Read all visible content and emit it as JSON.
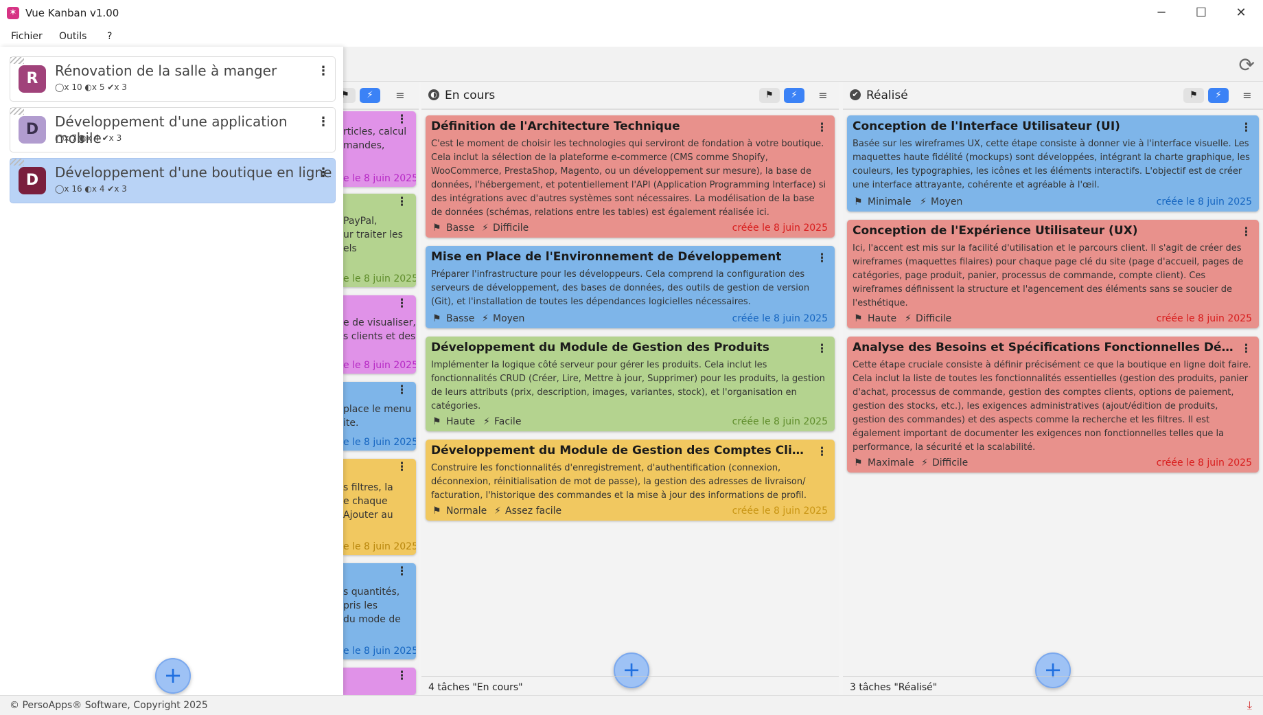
{
  "window": {
    "title": "Vue Kanban v1.00",
    "minimize": "─",
    "maximize": "☐",
    "close": "✕"
  },
  "menu": [
    "Fichier",
    "Outils",
    "?"
  ],
  "colors": {
    "red": "#e8918c",
    "blue": "#7eb5e9",
    "green": "#b4d38f",
    "yellow": "#f1c860",
    "purple": "#e092e8",
    "accent": "#3b82f6"
  },
  "projects": [
    {
      "initial": "R",
      "name": "Rénovation de la salle à manger",
      "stats": "◯x 10  ◐x 5  ✔x 3",
      "color": "#a0427a"
    },
    {
      "initial": "D",
      "name": "Développement d'une application mobile",
      "stats": "◯x 7  ◐x 4  ✔x 3",
      "color": "#b19ccf"
    },
    {
      "initial": "D",
      "name": "Développement d'une boutique en ligne",
      "stats": "◯x 16  ◐x 4  ✔x 3",
      "color": "#7a1f3d"
    }
  ],
  "leftcol": {
    "cards": [
      {
        "text": "rticles, calcul\nmandes,",
        "date": "e le 8 juin 2025",
        "dcolor": "#b628c4"
      },
      {
        "text": "PayPal,\nur traiter les\nels",
        "date": "e le 8 juin 2025",
        "dcolor": "#5e8c2a"
      },
      {
        "text": "e de visualiser,\ns clients et des",
        "date": "e le 8 juin 2025",
        "dcolor": "#b628c4"
      },
      {
        "text": "place le menu\nite.",
        "date": "e le 8 juin 2025",
        "dcolor": "#1565c0"
      },
      {
        "text": "s filtres, la\ne chaque\nAjouter au",
        "date": "e le 8 juin 2025",
        "dcolor": "#b8860b"
      },
      {
        "text": "s quantités,\npris les\ndu mode de",
        "date": "e le 8 juin 2025",
        "dcolor": "#1565c0"
      }
    ]
  },
  "columns": {
    "encours": {
      "title": "En cours",
      "count": "4 tâches \"En cours\"",
      "cards": [
        {
          "title": "Définition de l'Architecture Technique",
          "desc": "C'est le moment de choisir les technologies qui serviront de fondation à votre boutique. Cela inclut la sélection de la plateforme e-commerce (CMS comme Shopify, WooCommerce, PrestaShop, Magento, ou un développement sur mesure), la base de données, l'hébergement, et potentiellement l'API (Application Programming Interface) si des intégrations avec d'autres systèmes sont nécessaires. La modélisation de la base de données (schémas, relations entre les tables) est également réalisée ici.",
          "priority": "Basse",
          "difficulty": "Difficile",
          "date": "créée le 8 juin 2025",
          "dcolor": "#d81b1b"
        },
        {
          "title": "Mise en Place de l'Environnement de Développement",
          "desc": "Préparer l'infrastructure pour les développeurs. Cela comprend la configuration des serveurs de développement, des bases de données, des outils de gestion de version (Git), et l'installation de toutes les dépendances logicielles nécessaires.",
          "priority": "Basse",
          "difficulty": "Moyen",
          "date": "créée le 8 juin 2025",
          "dcolor": "#1565c0"
        },
        {
          "title": "Développement du Module de Gestion des Produits",
          "desc": "Implémenter la logique côté serveur pour gérer les produits. Cela inclut les fonctionnalités CRUD (Créer, Lire, Mettre à jour, Supprimer) pour les produits, la gestion de leurs attributs (prix, description, images, variantes, stock), et l'organisation en catégories.",
          "priority": "Haute",
          "difficulty": "Facile",
          "date": "créée le 8 juin 2025",
          "dcolor": "#5e8c2a"
        },
        {
          "title": "Développement du Module de Gestion des Comptes Clients",
          "desc": "Construire les fonctionnalités d'enregistrement, d'authentification (connexion, déconnexion, réinitialisation de mot de passe), la gestion des adresses de livraison/ facturation, l'historique des commandes et la mise à jour des informations de profil.",
          "priority": "Normale",
          "difficulty": "Assez facile",
          "date": "créée le 8 juin 2025",
          "dcolor": "#c89513"
        }
      ]
    },
    "realise": {
      "title": "Réalisé",
      "count": "3 tâches \"Réalisé\"",
      "cards": [
        {
          "title": "Conception de l'Interface Utilisateur (UI)",
          "desc": "Basée sur les wireframes UX, cette étape consiste à donner vie à l'interface visuelle. Les maquettes haute fidélité (mockups) sont développées, intégrant la charte graphique, les couleurs, les typographies, les icônes et les éléments interactifs. L'objectif est de créer une interface attrayante, cohérente et agréable à l'œil.",
          "priority": "Minimale",
          "difficulty": "Moyen",
          "date": "créée le 8 juin 2025",
          "dcolor": "#1565c0"
        },
        {
          "title": "Conception de l'Expérience Utilisateur (UX)",
          "desc": "Ici, l'accent est mis sur la facilité d'utilisation et le parcours client. Il s'agit de créer des wireframes (maquettes filaires) pour chaque page clé du site (page d'accueil, pages de catégories, page produit, panier, processus de commande, compte client). Ces wireframes définissent la structure et l'agencement des éléments sans se soucier de l'esthétique.",
          "priority": "Haute",
          "difficulty": "Difficile",
          "date": "créée le 8 juin 2025",
          "dcolor": "#d81b1b"
        },
        {
          "title": "Analyse des Besoins et Spécifications Fonctionnelles Détaillées (S...",
          "desc": "Cette étape cruciale consiste à définir précisément ce que la boutique en ligne doit faire. Cela inclut la liste de toutes les fonctionnalités essentielles (gestion des produits, panier d'achat, processus de commande, gestion des comptes clients, options de paiement, gestion des stocks, etc.), les exigences administratives (ajout/édition de produits, gestion des commandes) et des aspects comme la recherche et les filtres. Il est également important de documenter les exigences non fonctionnelles telles que la performance, la sécurité et la scalabilité.",
          "priority": "Maximale",
          "difficulty": "Difficile",
          "date": "créée le 8 juin 2025",
          "dcolor": "#d81b1b"
        }
      ]
    }
  },
  "status": {
    "text": "© PersoApps® Software, Copyright 2025"
  }
}
